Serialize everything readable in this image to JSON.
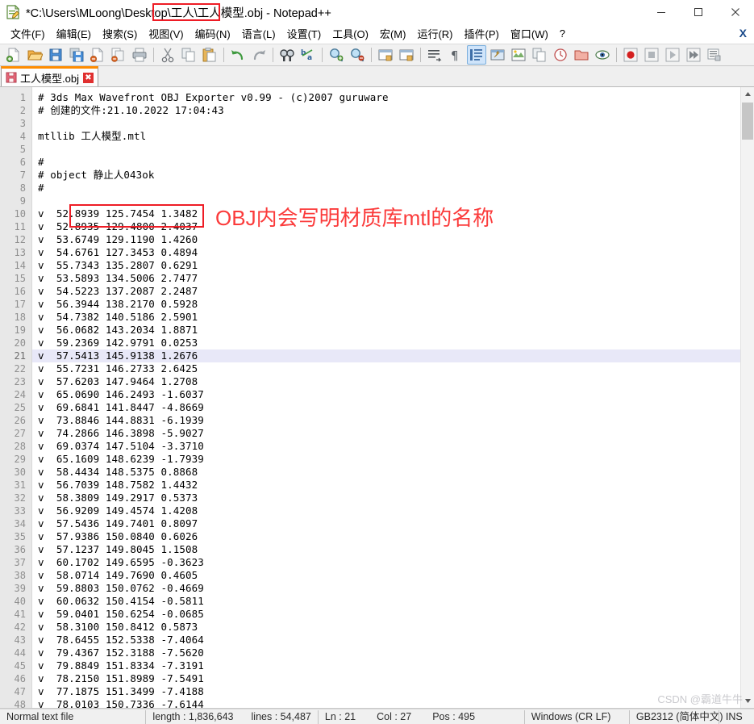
{
  "window": {
    "title_prefix": "*C:\\Users\\MLoong\\Desktop\\工人\\",
    "title_highlight": "工人模型.obj",
    "title_suffix": " - Notepad++",
    "icon": "notepad-plus-plus-icon",
    "controls": {
      "minimize": "minimize-icon",
      "maximize": "maximize-icon",
      "close": "close-icon"
    }
  },
  "menubar": {
    "items": [
      {
        "label": "文件(F)",
        "name": "menu-file"
      },
      {
        "label": "编辑(E)",
        "name": "menu-edit"
      },
      {
        "label": "搜索(S)",
        "name": "menu-search"
      },
      {
        "label": "视图(V)",
        "name": "menu-view"
      },
      {
        "label": "编码(N)",
        "name": "menu-encoding"
      },
      {
        "label": "语言(L)",
        "name": "menu-language"
      },
      {
        "label": "设置(T)",
        "name": "menu-settings"
      },
      {
        "label": "工具(O)",
        "name": "menu-tools"
      },
      {
        "label": "宏(M)",
        "name": "menu-macro"
      },
      {
        "label": "运行(R)",
        "name": "menu-run"
      },
      {
        "label": "插件(P)",
        "name": "menu-plugins"
      },
      {
        "label": "窗口(W)",
        "name": "menu-window"
      },
      {
        "label": "?",
        "name": "menu-help"
      }
    ],
    "close_document": "X"
  },
  "toolbar": {
    "buttons": [
      "new-file-icon",
      "open-file-icon",
      "save-icon",
      "save-all-icon",
      "close-file-icon",
      "close-all-icon",
      "print-icon",
      "sep",
      "cut-icon",
      "copy-icon",
      "paste-icon",
      "sep",
      "undo-icon",
      "redo-icon",
      "sep",
      "find-icon",
      "replace-icon",
      "sep",
      "zoom-in-icon",
      "zoom-out-icon",
      "sep",
      "sync-vertical-scroll-icon",
      "sync-horizontal-scroll-icon",
      "sep",
      "word-wrap-icon",
      "show-all-characters-icon",
      "show-indent-guide-icon",
      "user-defined-dialog-icon",
      "document-map-icon",
      "function-list-icon",
      "folder-as-workspace-icon",
      "monitoring-icon",
      "sep",
      "record-macro-icon",
      "stop-recording-icon",
      "playback-icon",
      "run-multiple-times-icon",
      "save-macro-icon"
    ]
  },
  "tabs": [
    {
      "label": "工人模型.obj",
      "icon": "saved-file-icon",
      "close": "✖",
      "active": true
    }
  ],
  "editor": {
    "first_line": 1,
    "current_line": 21,
    "lines": [
      {
        "n": 1,
        "text": "# 3ds Max Wavefront OBJ Exporter v0.99 - (c)2007 guruware"
      },
      {
        "n": 2,
        "text": "# 创建的文件:21.10.2022 17:04:43"
      },
      {
        "n": 3,
        "text": ""
      },
      {
        "n": 4,
        "text": "mtllib 工人模型.mtl"
      },
      {
        "n": 5,
        "text": ""
      },
      {
        "n": 6,
        "text": "#"
      },
      {
        "n": 7,
        "text": "# object 静止人043ok"
      },
      {
        "n": 8,
        "text": "#"
      },
      {
        "n": 9,
        "text": ""
      },
      {
        "n": 10,
        "text": "v  52.8939 125.7454 1.3482"
      },
      {
        "n": 11,
        "text": "v  52.8935 129.4800 2.4037"
      },
      {
        "n": 12,
        "text": "v  53.6749 129.1190 1.4260"
      },
      {
        "n": 13,
        "text": "v  54.6761 127.3453 0.4894"
      },
      {
        "n": 14,
        "text": "v  55.7343 135.2807 0.6291"
      },
      {
        "n": 15,
        "text": "v  53.5893 134.5006 2.7477"
      },
      {
        "n": 16,
        "text": "v  54.5223 137.2087 2.2487"
      },
      {
        "n": 17,
        "text": "v  56.3944 138.2170 0.5928"
      },
      {
        "n": 18,
        "text": "v  54.7382 140.5186 2.5901"
      },
      {
        "n": 19,
        "text": "v  56.0682 143.2034 1.8871"
      },
      {
        "n": 20,
        "text": "v  59.2369 142.9791 0.0253"
      },
      {
        "n": 21,
        "text": "v  57.5413 145.9138 1.2676"
      },
      {
        "n": 22,
        "text": "v  55.7231 146.2733 2.6425"
      },
      {
        "n": 23,
        "text": "v  57.6203 147.9464 1.2708"
      },
      {
        "n": 24,
        "text": "v  65.0690 146.2493 -1.6037"
      },
      {
        "n": 25,
        "text": "v  69.6841 141.8447 -4.8669"
      },
      {
        "n": 26,
        "text": "v  73.8846 144.8831 -6.1939"
      },
      {
        "n": 27,
        "text": "v  74.2866 146.3898 -5.9027"
      },
      {
        "n": 28,
        "text": "v  69.0374 147.5104 -3.3710"
      },
      {
        "n": 29,
        "text": "v  65.1609 148.6239 -1.7939"
      },
      {
        "n": 30,
        "text": "v  58.4434 148.5375 0.8868"
      },
      {
        "n": 31,
        "text": "v  56.7039 148.7582 1.4432"
      },
      {
        "n": 32,
        "text": "v  58.3809 149.2917 0.5373"
      },
      {
        "n": 33,
        "text": "v  56.9209 149.4574 1.4208"
      },
      {
        "n": 34,
        "text": "v  57.5436 149.7401 0.8097"
      },
      {
        "n": 35,
        "text": "v  57.9386 150.0840 0.6026"
      },
      {
        "n": 36,
        "text": "v  57.1237 149.8045 1.1508"
      },
      {
        "n": 37,
        "text": "v  60.1702 149.6595 -0.3623"
      },
      {
        "n": 38,
        "text": "v  58.0714 149.7690 0.4605"
      },
      {
        "n": 39,
        "text": "v  59.8803 150.0762 -0.4669"
      },
      {
        "n": 40,
        "text": "v  60.0632 150.4154 -0.5811"
      },
      {
        "n": 41,
        "text": "v  59.0401 150.6254 -0.0685"
      },
      {
        "n": 42,
        "text": "v  58.3100 150.8412 0.5873"
      },
      {
        "n": 43,
        "text": "v  78.6455 152.5338 -7.4064"
      },
      {
        "n": 44,
        "text": "v  79.4367 152.3188 -7.5620"
      },
      {
        "n": 45,
        "text": "v  79.8849 151.8334 -7.3191"
      },
      {
        "n": 46,
        "text": "v  78.2150 151.8989 -7.5491"
      },
      {
        "n": 47,
        "text": "v  77.1875 151.3499 -7.4188"
      },
      {
        "n": 48,
        "text": "v  78.0103 150.7336 -7.6144"
      }
    ]
  },
  "annotation": {
    "text": "OBJ内会写明材质库mtl的名称",
    "color": "#fb3b3b"
  },
  "statusbar": {
    "file_type": "Normal text file",
    "length_label": "length : 1,836,643",
    "lines_label": "lines : 54,487",
    "ln": "Ln : 21",
    "col": "Col : 27",
    "pos": "Pos : 495",
    "eol": "Windows (CR LF)",
    "encoding": "GB2312 (简体中文)",
    "insert_mode": "INS"
  },
  "watermark": "CSDN @霸道牛牛"
}
